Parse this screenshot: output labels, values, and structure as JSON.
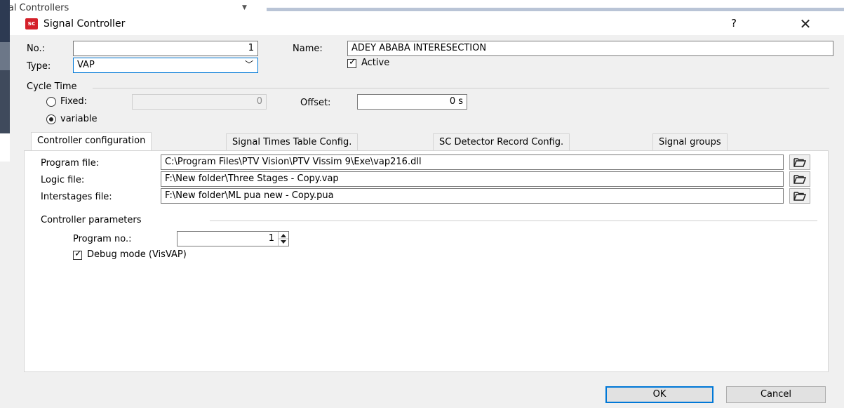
{
  "background": {
    "window_title": "ınal Controllers"
  },
  "dialog": {
    "title": "Signal Controller",
    "app_icon_text": "sc",
    "help_label": "?",
    "close_label": "✕"
  },
  "form": {
    "no_label": "No.:",
    "no_value": "1",
    "name_label": "Name:",
    "name_value": "ADEY ABABA INTERESECTION",
    "type_label": "Type:",
    "type_value": "VAP",
    "active_label": "Active",
    "active_checked": true
  },
  "cycle_time": {
    "group_label": "Cycle Time",
    "fixed_label": "Fixed:",
    "fixed_value": "0",
    "variable_label": "variable",
    "offset_label": "Offset:",
    "offset_value": "0 s",
    "selected": "variable"
  },
  "tabs": [
    {
      "label": "Controller configuration",
      "active": true
    },
    {
      "label": "Signal Times Table Config.",
      "active": false
    },
    {
      "label": "SC Detector Record Config.",
      "active": false
    },
    {
      "label": "Signal groups",
      "active": false
    }
  ],
  "files": {
    "program_label": "Program file:",
    "program_value": "C:\\Program Files\\PTV Vision\\PTV Vissim 9\\Exe\\vap216.dll",
    "logic_label": "Logic file:",
    "logic_value": "F:\\New folder\\Three Stages - Copy.vap",
    "interstages_label": "Interstages file:",
    "interstages_value": "F:\\New folder\\ML pua new  - Copy.pua"
  },
  "controller_params": {
    "group_label": "Controller parameters",
    "program_no_label": "Program no.:",
    "program_no_value": "1",
    "debug_label": "Debug mode (VisVAP)",
    "debug_checked": true
  },
  "footer": {
    "ok_label": "OK",
    "cancel_label": "Cancel"
  },
  "icons": [
    "folder-open-icon",
    "close-icon",
    "help-icon",
    "chevron-down-icon",
    "spin-up-icon",
    "spin-down-icon",
    "checkmark-icon"
  ]
}
